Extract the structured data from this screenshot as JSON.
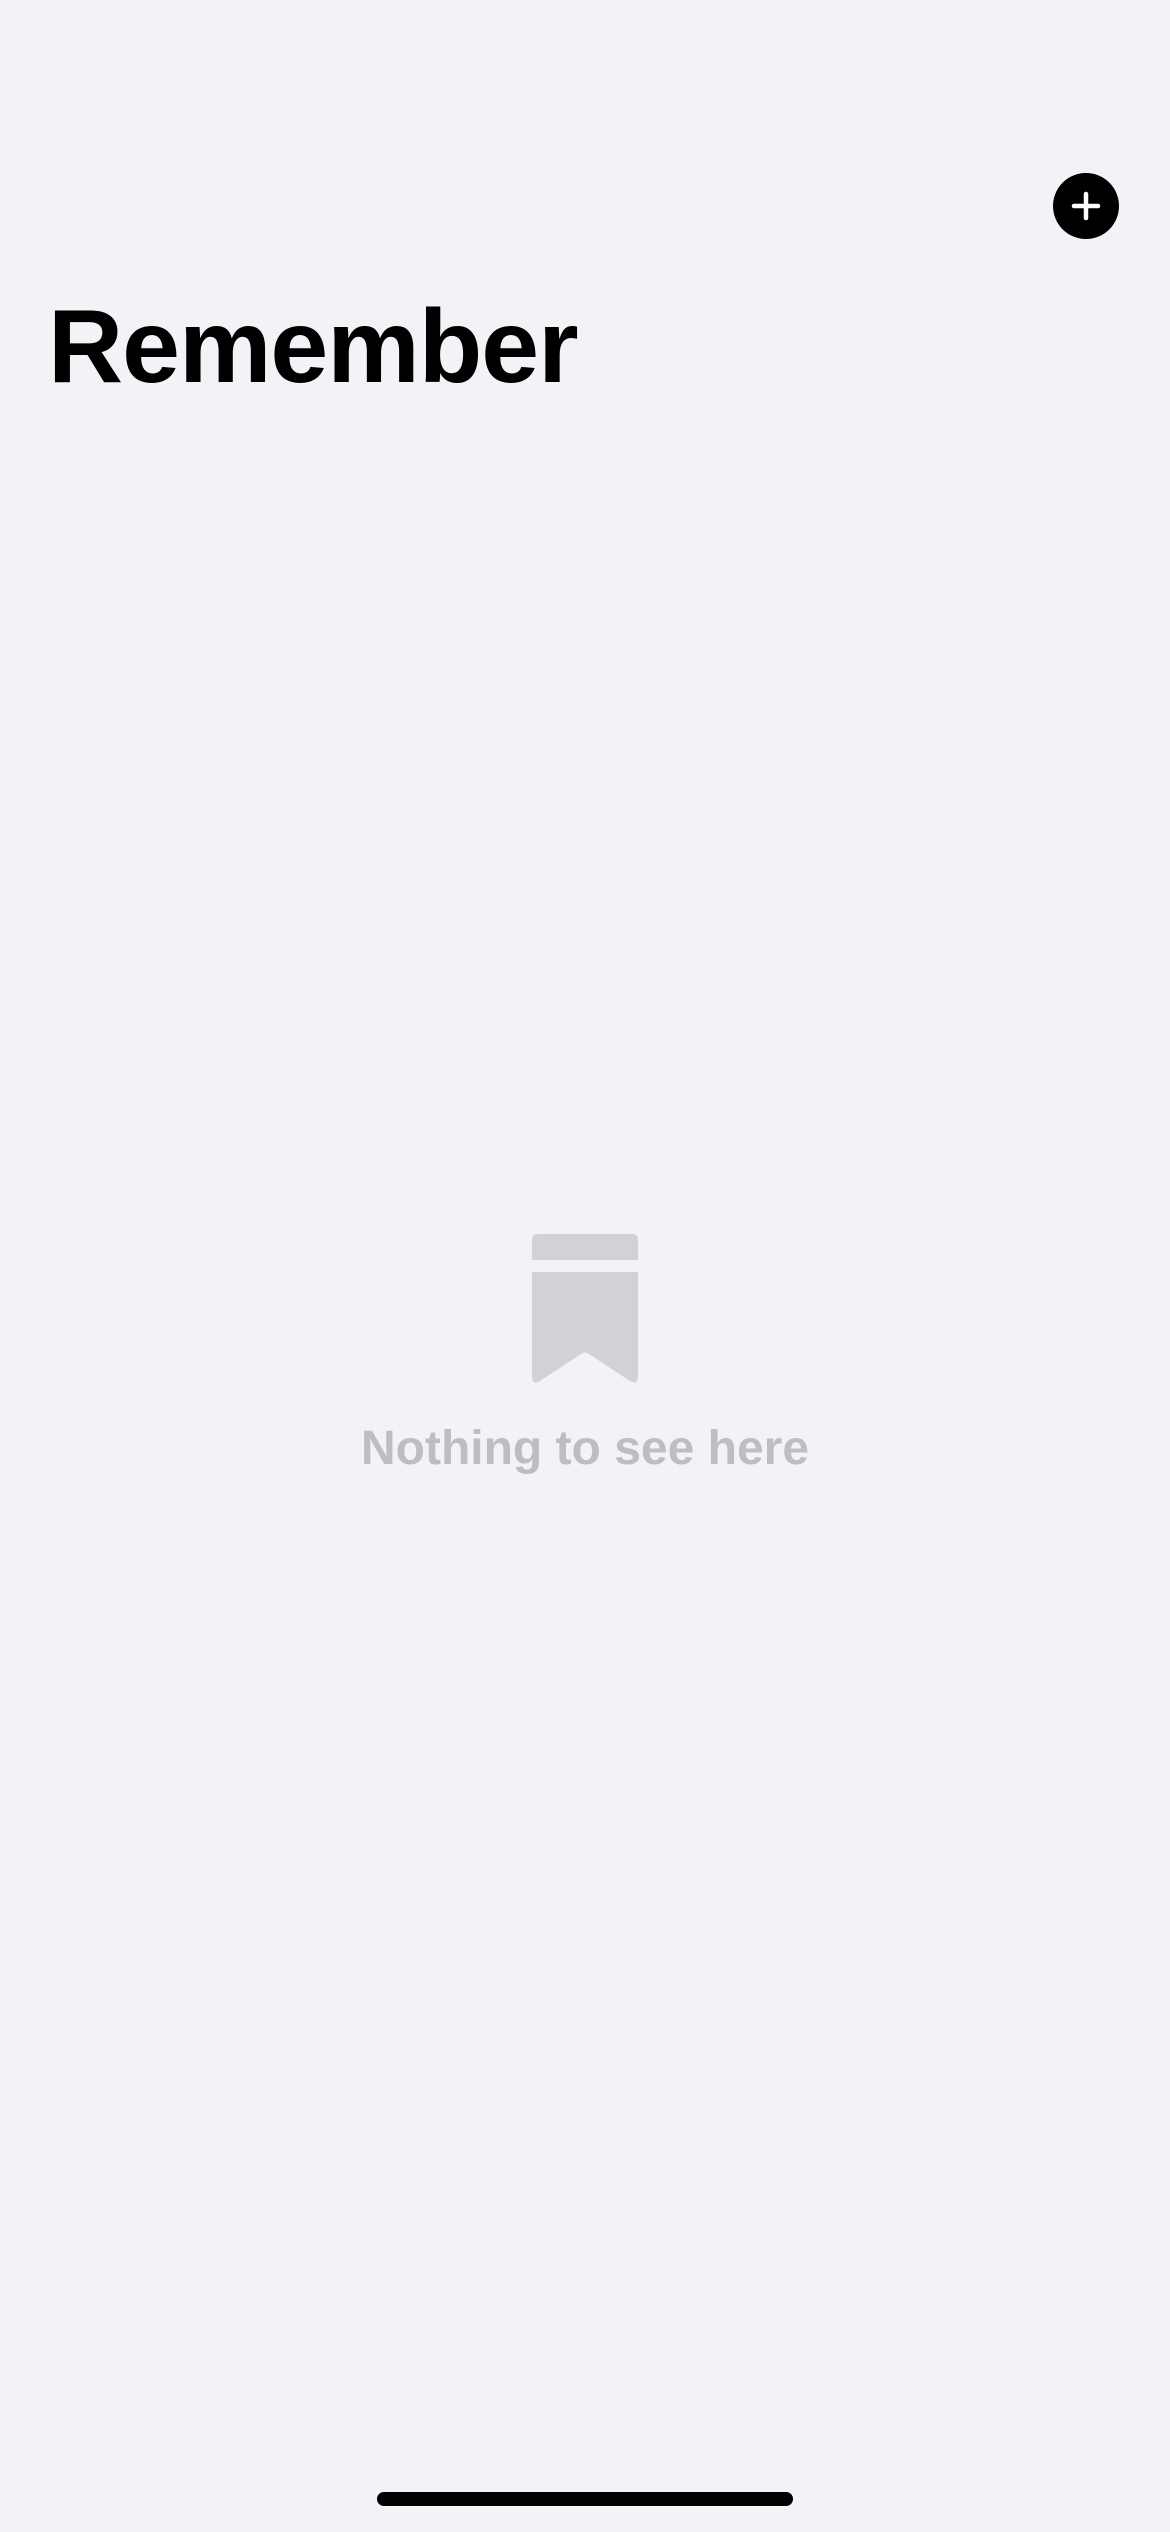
{
  "header": {
    "title": "Remember",
    "add_button": {
      "icon": "plus-circle-icon",
      "color": "#000000"
    }
  },
  "empty_state": {
    "icon": "bookmark-icon",
    "icon_color": "#d1d1d6",
    "message": "Nothing to see here",
    "message_color": "#bdbdc2"
  },
  "colors": {
    "background": "#f2f2f7",
    "title": "#000000"
  }
}
